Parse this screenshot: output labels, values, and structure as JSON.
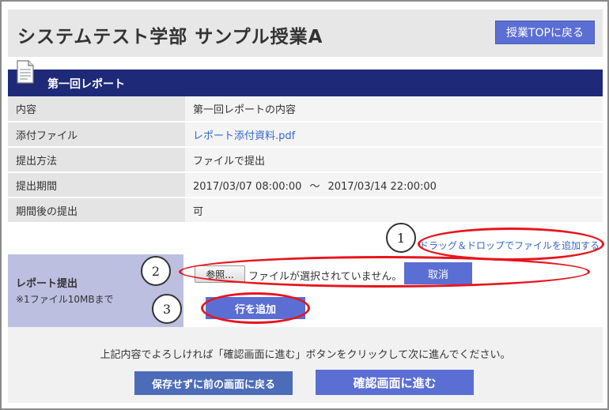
{
  "header": {
    "title": "システムテスト学部  サンプル授業A",
    "top_button": "授業TOPに戻る"
  },
  "section": {
    "title": "第一回レポート",
    "icon": "document-icon"
  },
  "info_rows": [
    {
      "label": "内容",
      "value": "第一回レポートの内容"
    },
    {
      "label": "添付ファイル",
      "value": "レポート添付資料.pdf"
    },
    {
      "label": "提出方法",
      "value": "ファイルで提出"
    },
    {
      "label": "提出期間",
      "start": "2017/03/07 08:00:00",
      "sep": "〜",
      "end": "2017/03/14 22:00:00"
    },
    {
      "label": "期間後の提出",
      "value": "可"
    }
  ],
  "dragdrop_link": "ドラッグ＆ドロップでファイルを追加する",
  "submit": {
    "label": "レポート提出",
    "note": "※1ファイル10MBまで",
    "browse_button": "参照...",
    "no_file_text": "ファイルが選択されていません。",
    "cancel_button": "取消",
    "add_row_button": "行を追加"
  },
  "footer": {
    "confirm_text": "上記内容でよろしければ「確認画面に進む」ボタンをクリックして次に進んでください。",
    "back_button": "保存せずに前の画面に戻る",
    "next_button": "確認画面に進む"
  },
  "annotations": [
    "1",
    "2",
    "3"
  ],
  "colors": {
    "section_bar": "#1e2a78",
    "button_blue": "#5b6ed3",
    "link_blue": "#3366cc",
    "annotation_red": "#e8141e"
  }
}
